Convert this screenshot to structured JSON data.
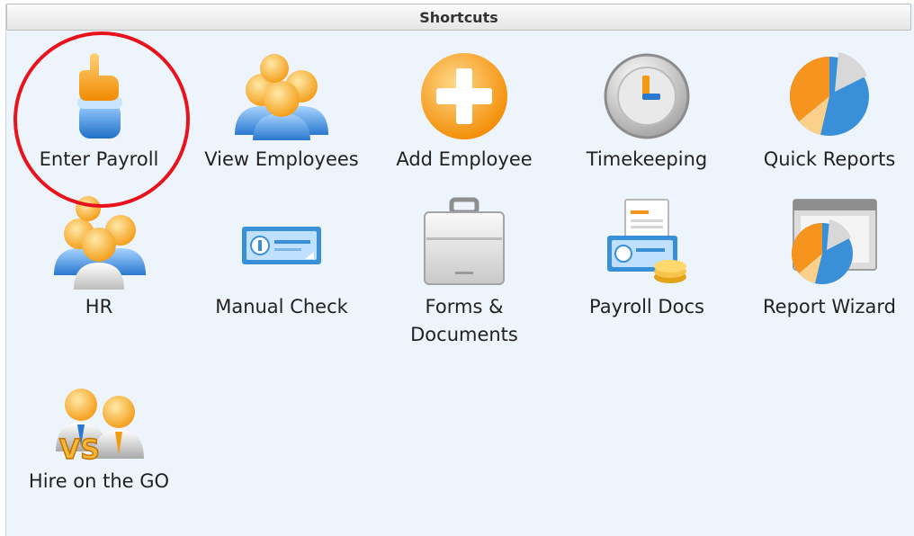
{
  "panel": {
    "title": "Shortcuts"
  },
  "shortcuts": [
    {
      "label": "Enter Payroll",
      "icon": "pointing-hand-icon"
    },
    {
      "label": "View Employees",
      "icon": "people-group-icon"
    },
    {
      "label": "Add Employee",
      "icon": "add-plus-icon"
    },
    {
      "label": "Timekeeping",
      "icon": "clock-icon"
    },
    {
      "label": "Quick Reports",
      "icon": "pie-chart-icon"
    },
    {
      "label": "HR",
      "icon": "hr-people-icon"
    },
    {
      "label": "Manual Check",
      "icon": "check-icon"
    },
    {
      "label": "Forms &\nDocuments",
      "icon": "briefcase-icon"
    },
    {
      "label": "Payroll Docs",
      "icon": "payroll-docs-icon"
    },
    {
      "label": "Report Wizard",
      "icon": "report-wizard-icon"
    },
    {
      "label": "Hire on the GO",
      "icon": "hire-vs-icon"
    }
  ],
  "colors": {
    "accent_orange": "#f7941d",
    "accent_blue": "#3a8fd9",
    "highlight_ring": "#e8131b",
    "panel_bg": "#eef4fc"
  }
}
